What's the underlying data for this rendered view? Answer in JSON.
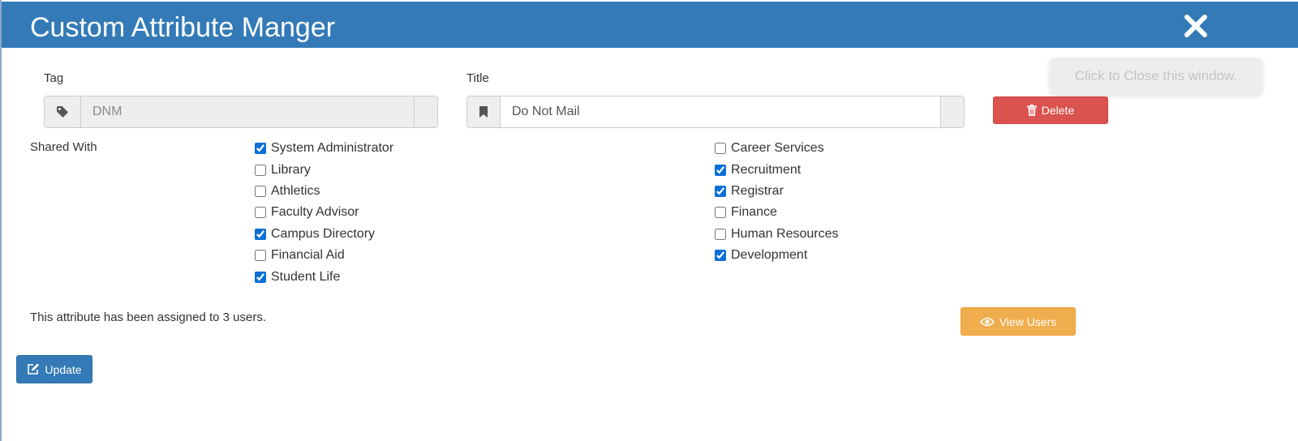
{
  "header": {
    "title": "Custom Attribute Manger"
  },
  "tooltip": {
    "text": "Click to Close this window."
  },
  "tag_field": {
    "label": "Tag",
    "value": "DNM",
    "icon": "tag-icon"
  },
  "title_field": {
    "label": "Title",
    "value": "Do Not Mail",
    "icon": "bookmark-icon"
  },
  "buttons": {
    "delete": "Delete",
    "view_users": "View Users",
    "update": "Update"
  },
  "shared_with": {
    "label": "Shared With",
    "left": [
      {
        "label": "System Administrator",
        "checked": true
      },
      {
        "label": "Library",
        "checked": false
      },
      {
        "label": "Athletics",
        "checked": false
      },
      {
        "label": "Faculty Advisor",
        "checked": false
      },
      {
        "label": "Campus Directory",
        "checked": true
      },
      {
        "label": "Financial Aid",
        "checked": false
      },
      {
        "label": "Student Life",
        "checked": true
      }
    ],
    "right": [
      {
        "label": "Career Services",
        "checked": false
      },
      {
        "label": "Recruitment",
        "checked": true
      },
      {
        "label": "Registrar",
        "checked": true
      },
      {
        "label": "Finance",
        "checked": false
      },
      {
        "label": "Human Resources",
        "checked": false
      },
      {
        "label": "Development",
        "checked": true
      }
    ]
  },
  "assignment": {
    "text": "This attribute has been assigned to 3 users."
  },
  "colors": {
    "header": "#337ab7",
    "delete": "#d9534f",
    "view_users": "#f0ad4e",
    "update": "#337ab7"
  }
}
